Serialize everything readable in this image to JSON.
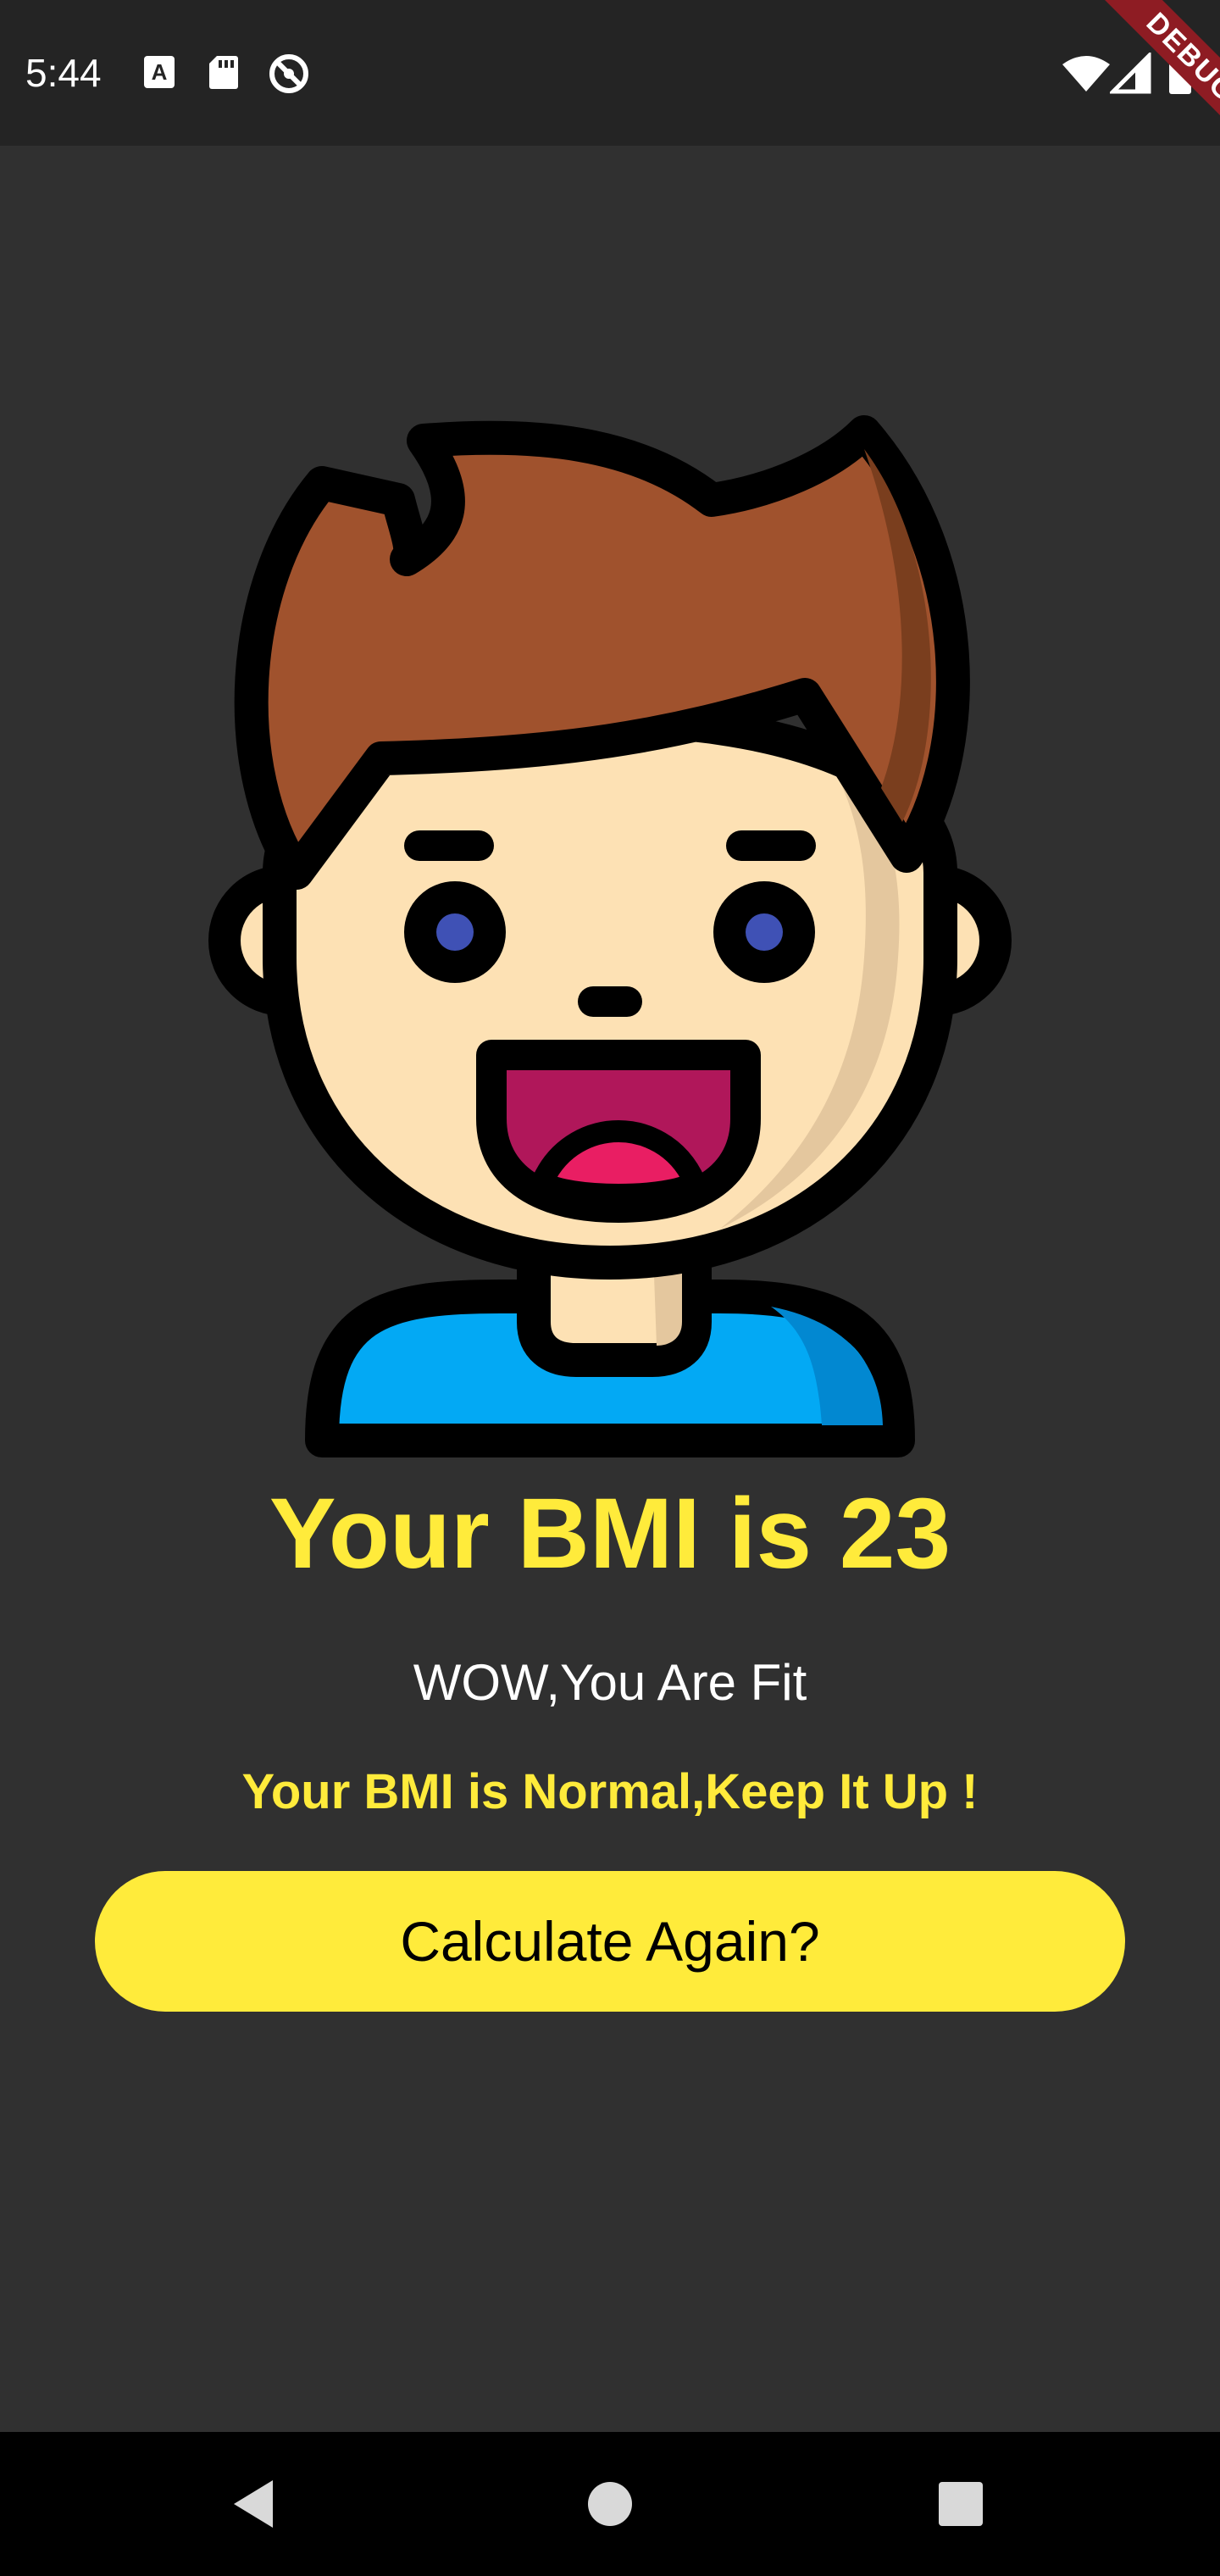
{
  "status_bar": {
    "time": "5:44",
    "icons": [
      "keyboard-a-icon",
      "sd-card-icon",
      "do-not-disturb-icon",
      "wifi-icon",
      "signal-icon",
      "battery-icon"
    ],
    "debug_label": "DEBUG"
  },
  "result": {
    "avatar": "happy-boy-avatar",
    "title": "Your BMI is 23",
    "subtitle": "WOW,You Are Fit",
    "message": "Your BMI is Normal,Keep It Up !",
    "button_label": "Calculate Again?"
  },
  "colors": {
    "background": "#303030",
    "status_bar": "#242424",
    "accent": "#ffeb3b",
    "text_white": "#ffffff",
    "debug_ribbon": "#8e1c23"
  },
  "nav_bar": {
    "buttons": [
      "back-icon",
      "home-icon",
      "recents-icon"
    ]
  }
}
